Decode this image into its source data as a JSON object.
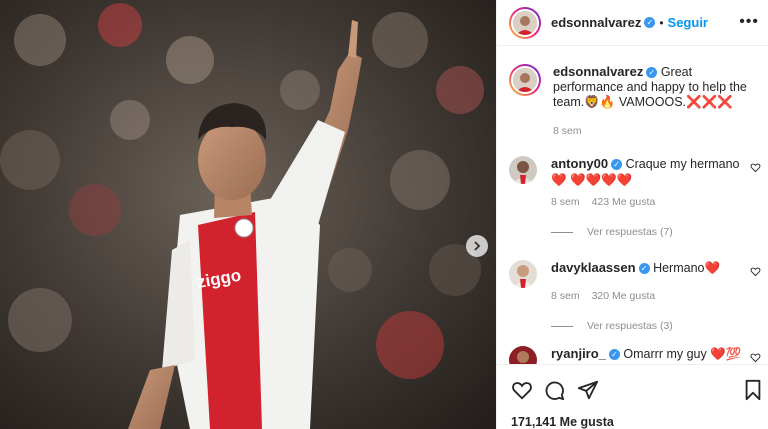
{
  "post": {
    "username": "edsonnalvarez",
    "follow_label": "Seguir",
    "more_label": "•••",
    "caption_text": "Great performance and happy to help the team.🦁🔥 VAMOOOS.❌❌❌",
    "caption_age": "8 sem",
    "likes_label": "171,141 Me gusta"
  },
  "comments": [
    {
      "username": "antony00",
      "text": "Craque my hermano ❤️ ❤️❤️❤️❤️",
      "age": "8 sem",
      "likes": "423 Me gusta",
      "replies": "Ver respuestas (7)"
    },
    {
      "username": "davyklaassen",
      "text": "Hermano❤️",
      "age": "8 sem",
      "likes": "320 Me gusta",
      "replies": "Ver respuestas (3)"
    },
    {
      "username": "ryanjiro_",
      "text": "Omarrr my guy ❤️💯"
    }
  ],
  "icons": {
    "verified": "verified-badge-icon",
    "heart": "heart-icon",
    "comment": "comment-icon",
    "share": "share-icon",
    "bookmark": "bookmark-icon",
    "next": "chevron-right-icon"
  },
  "colors": {
    "link_blue": "#0095f6",
    "verified_blue": "#3897f0",
    "text_dark": "#262626",
    "meta_gray": "#8e8e8e",
    "jersey_red": "#d2222d"
  }
}
